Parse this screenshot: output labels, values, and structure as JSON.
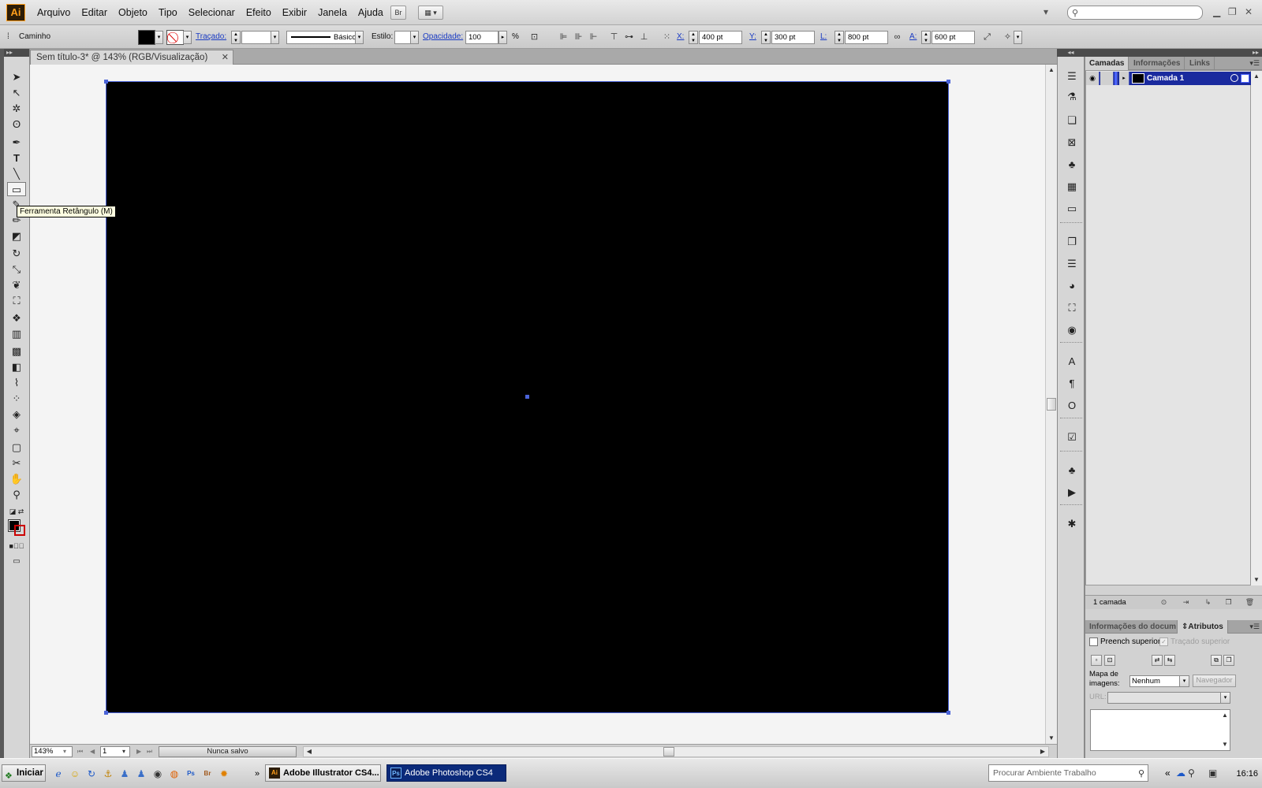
{
  "app": {
    "logo": "Ai",
    "menu": [
      "Arquivo",
      "Editar",
      "Objeto",
      "Tipo",
      "Selecionar",
      "Efeito",
      "Exibir",
      "Janela",
      "Ajuda"
    ],
    "bridge_button": "Br",
    "search_placeholder": ""
  },
  "control_bar": {
    "object_type": "Caminho",
    "stroke_label": "Traçado:",
    "stroke_profile": "Básico",
    "style_label": "Estilo:",
    "opacity_label": "Opacidade:",
    "opacity_value": "100",
    "opacity_unit": "%",
    "x_label": "X:",
    "x_value": "400 pt",
    "y_label": "Y:",
    "y_value": "300 pt",
    "w_label": "L:",
    "w_value": "800 pt",
    "h_label": "A:",
    "h_value": "600 pt",
    "fill_color": "#000000"
  },
  "document": {
    "tab_title": "Sem título-3* @ 143% (RGB/Visualização)",
    "artboard_color": "#000000",
    "selection_color": "#4a63d8"
  },
  "toolbar": {
    "tooltip": "Ferramenta Retângulo (M)",
    "selected_tool": "rectangle-tool"
  },
  "status_bar": {
    "zoom": "143%",
    "artboard_number": "1",
    "status_text": "Nunca salvo"
  },
  "layers_panel": {
    "tabs": [
      "Camadas",
      "Informações",
      "Links"
    ],
    "active_tab": "Camadas",
    "layer_name": "Camada 1",
    "layer_count": "1 camada",
    "layer_highlight_color": "#1a2a9e"
  },
  "attributes_panel": {
    "tabs": [
      "Informações do docum",
      "Atributos"
    ],
    "active_tab": "Atributos",
    "overprint_fill_label": "Preench superior",
    "overprint_stroke_label": "Traçado superior",
    "image_map_label_1": "Mapa de",
    "image_map_label_2": "imagens:",
    "image_map_value": "Nenhum",
    "navigator_button": "Navegador",
    "url_label": "URL:"
  },
  "taskbar": {
    "start_label": "Iniciar",
    "illustrator_icon": "Ai",
    "illustrator_task": "Adobe Illustrator CS4...",
    "photoshop_icon": "Ps",
    "photoshop_task": "Adobe Photoshop CS4",
    "search_placeholder": "Procurar Ambiente Trabalho",
    "tray_chevron": "«",
    "clock": "16:16"
  }
}
